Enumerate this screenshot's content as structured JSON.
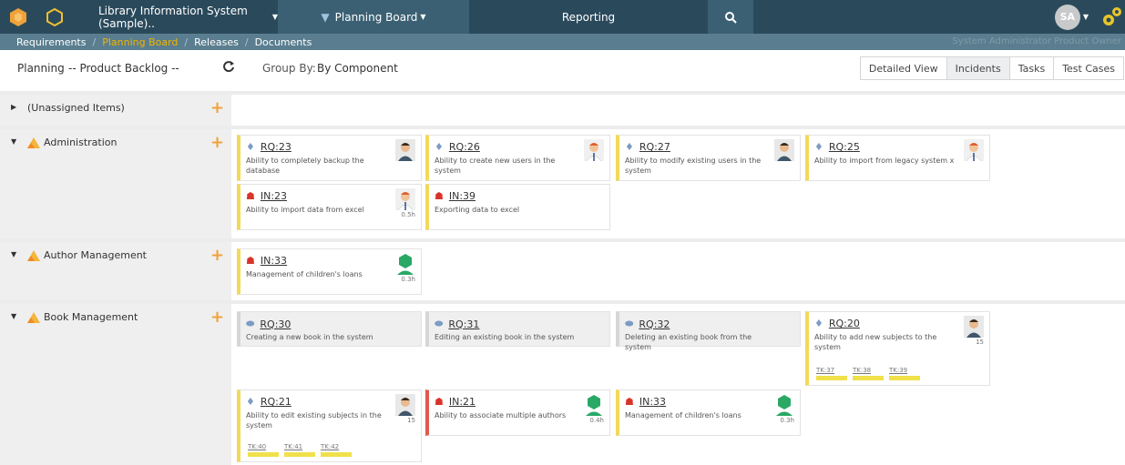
{
  "topbar": {
    "product_selector": "Library Information System (Sample)..",
    "planning_menu": "Planning Board",
    "reporting_menu": "Reporting",
    "avatar_initials": "SA"
  },
  "breadcrumb": {
    "items": [
      "Requirements",
      "Planning Board",
      "Releases",
      "Documents"
    ],
    "user_line": "System Administrator Product Owner"
  },
  "toolbar": {
    "planning_label": "Planning",
    "planning_value": "-- Product Backlog --",
    "groupby_label": "Group By:",
    "groupby_value": "By Component",
    "view_buttons": [
      "Detailed View",
      "Incidents",
      "Tasks",
      "Test Cases"
    ]
  },
  "groups": [
    {
      "name": "(Unassigned Items)"
    },
    {
      "name": "Administration"
    },
    {
      "name": "Author Management"
    },
    {
      "name": "Book Management"
    }
  ],
  "cards": {
    "rq23": {
      "id": "RQ:23",
      "desc": "Ability to completely backup the database"
    },
    "rq26": {
      "id": "RQ:26",
      "desc": "Ability to create new users in the system"
    },
    "rq27": {
      "id": "RQ:27",
      "desc": "Ability to modify existing users in the system"
    },
    "rq25": {
      "id": "RQ:25",
      "desc": "Ability to import from legacy system x"
    },
    "in23": {
      "id": "IN:23",
      "desc": "Ability to import data from excel",
      "est": "0.5h"
    },
    "in39": {
      "id": "IN:39",
      "desc": "Exporting data to excel"
    },
    "in33a": {
      "id": "IN:33",
      "desc": "Management of children's loans",
      "est": "0.3h"
    },
    "rq30": {
      "id": "RQ:30",
      "desc": "Creating a new book in the system"
    },
    "rq31": {
      "id": "RQ:31",
      "desc": "Editing an existing book in the system"
    },
    "rq32": {
      "id": "RQ:32",
      "desc": "Deleting an existing book from the system"
    },
    "rq20": {
      "id": "RQ:20",
      "desc": "Ability to add new subjects to the system",
      "est": "15",
      "tasks": [
        "TK:37",
        "TK:38",
        "TK:39"
      ]
    },
    "rq21": {
      "id": "RQ:21",
      "desc": "Ability to edit existing subjects in the system",
      "est": "15",
      "tasks": [
        "TK:40",
        "TK:41",
        "TK:42"
      ]
    },
    "in21": {
      "id": "IN:21",
      "desc": "Ability to associate multiple authors",
      "est": "0.4h"
    },
    "in33b": {
      "id": "IN:33",
      "desc": "Management of children's loans",
      "est": "0.3h"
    }
  },
  "colors": {
    "nav_dark": "#2a4a5c",
    "nav_active": "#3b6074",
    "crumb_bar": "#5a7e8f",
    "accent_orange": "#f0a23a",
    "requirement_yellow": "#f3d95a",
    "incident_red": "#e05a4e"
  }
}
